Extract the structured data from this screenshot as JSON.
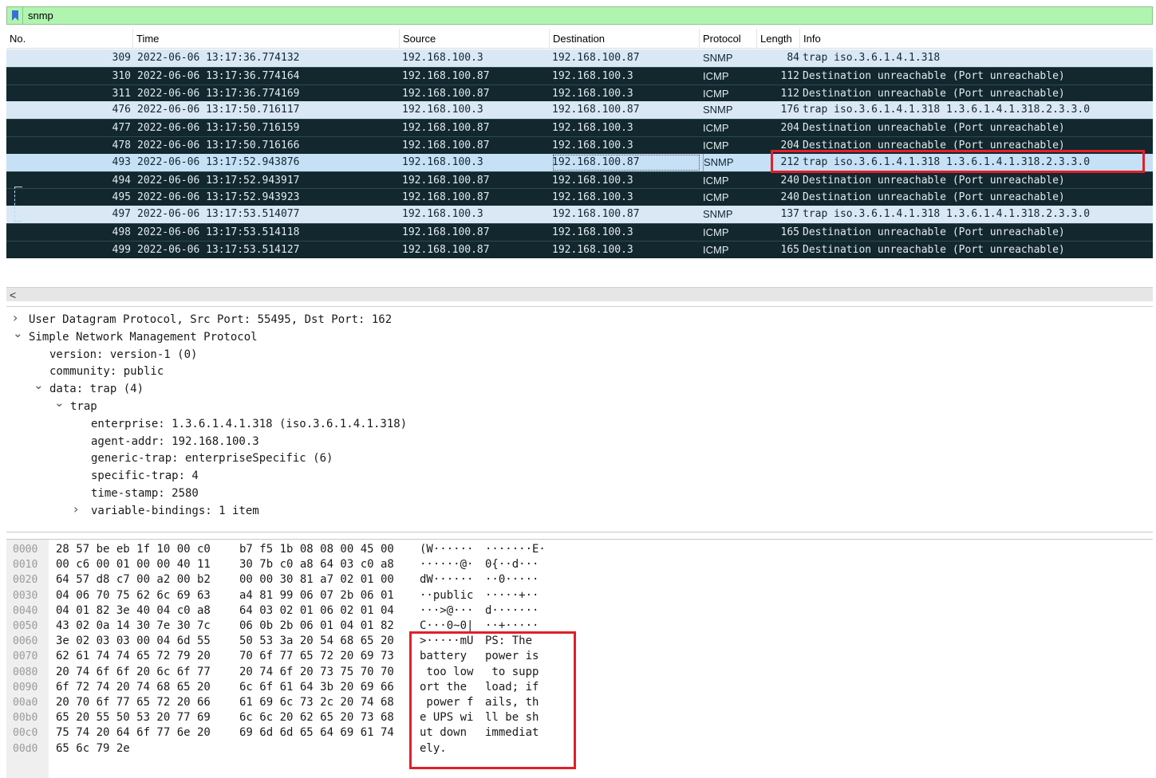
{
  "filter": {
    "value": "snmp",
    "icon": "bookmark-icon"
  },
  "columns": [
    "No.",
    "Time",
    "Source",
    "Destination",
    "Protocol",
    "Length",
    "Info"
  ],
  "packets": [
    {
      "no": "309",
      "time": "2022-06-06 13:17:36.774132",
      "src": "192.168.100.3",
      "dst": "192.168.100.87",
      "proto": "SNMP",
      "len": "84",
      "info": "trap iso.3.6.1.4.1.318",
      "style": "snmp"
    },
    {
      "no": "310",
      "time": "2022-06-06 13:17:36.774164",
      "src": "192.168.100.87",
      "dst": "192.168.100.3",
      "proto": "ICMP",
      "len": "112",
      "info": "Destination unreachable (Port unreachable)",
      "style": "icmp"
    },
    {
      "no": "311",
      "time": "2022-06-06 13:17:36.774169",
      "src": "192.168.100.87",
      "dst": "192.168.100.3",
      "proto": "ICMP",
      "len": "112",
      "info": "Destination unreachable (Port unreachable)",
      "style": "icmp"
    },
    {
      "no": "476",
      "time": "2022-06-06 13:17:50.716117",
      "src": "192.168.100.3",
      "dst": "192.168.100.87",
      "proto": "SNMP",
      "len": "176",
      "info": "trap iso.3.6.1.4.1.318 1.3.6.1.4.1.318.2.3.3.0",
      "style": "snmp"
    },
    {
      "no": "477",
      "time": "2022-06-06 13:17:50.716159",
      "src": "192.168.100.87",
      "dst": "192.168.100.3",
      "proto": "ICMP",
      "len": "204",
      "info": "Destination unreachable (Port unreachable)",
      "style": "icmp"
    },
    {
      "no": "478",
      "time": "2022-06-06 13:17:50.716166",
      "src": "192.168.100.87",
      "dst": "192.168.100.3",
      "proto": "ICMP",
      "len": "204",
      "info": "Destination unreachable (Port unreachable)",
      "style": "icmp"
    },
    {
      "no": "493",
      "time": "2022-06-06 13:17:52.943876",
      "src": "192.168.100.3",
      "dst": "192.168.100.87",
      "proto": "SNMP",
      "len": "212",
      "info": "trap iso.3.6.1.4.1.318 1.3.6.1.4.1.318.2.3.3.0",
      "style": "selected"
    },
    {
      "no": "494",
      "time": "2022-06-06 13:17:52.943917",
      "src": "192.168.100.87",
      "dst": "192.168.100.3",
      "proto": "ICMP",
      "len": "240",
      "info": "Destination unreachable (Port unreachable)",
      "style": "icmp"
    },
    {
      "no": "495",
      "time": "2022-06-06 13:17:52.943923",
      "src": "192.168.100.87",
      "dst": "192.168.100.3",
      "proto": "ICMP",
      "len": "240",
      "info": "Destination unreachable (Port unreachable)",
      "style": "icmp"
    },
    {
      "no": "497",
      "time": "2022-06-06 13:17:53.514077",
      "src": "192.168.100.3",
      "dst": "192.168.100.87",
      "proto": "SNMP",
      "len": "137",
      "info": "trap iso.3.6.1.4.1.318 1.3.6.1.4.1.318.2.3.3.0",
      "style": "snmp"
    },
    {
      "no": "498",
      "time": "2022-06-06 13:17:53.514118",
      "src": "192.168.100.87",
      "dst": "192.168.100.3",
      "proto": "ICMP",
      "len": "165",
      "info": "Destination unreachable (Port unreachable)",
      "style": "icmp"
    },
    {
      "no": "499",
      "time": "2022-06-06 13:17:53.514127",
      "src": "192.168.100.87",
      "dst": "192.168.100.3",
      "proto": "ICMP",
      "len": "165",
      "info": "Destination unreachable (Port unreachable)",
      "style": "icmp"
    }
  ],
  "scroll_left": "<",
  "details": [
    {
      "arrow": ">",
      "text": "User Datagram Protocol, Src Port: 55495, Dst Port: 162"
    },
    {
      "arrow": "v",
      "text": "Simple Network Management Protocol"
    },
    {
      "arrow": "",
      "text": "version: version-1 (0)"
    },
    {
      "arrow": "",
      "text": "community: public"
    },
    {
      "arrow": "v",
      "text": "data: trap (4)"
    },
    {
      "arrow": "v",
      "text": "trap"
    },
    {
      "arrow": "",
      "text": "enterprise: 1.3.6.1.4.1.318 (iso.3.6.1.4.1.318)"
    },
    {
      "arrow": "",
      "text": "agent-addr: 192.168.100.3"
    },
    {
      "arrow": "",
      "text": "generic-trap: enterpriseSpecific (6)"
    },
    {
      "arrow": "",
      "text": "specific-trap: 4"
    },
    {
      "arrow": "",
      "text": "time-stamp: 2580"
    },
    {
      "arrow": ">",
      "text": "variable-bindings: 1 item"
    }
  ],
  "hexdump": [
    {
      "off": "0000",
      "h1": "28 57 be eb 1f 10 00 c0",
      "h2": "b7 f5 1b 08 08 00 45 00",
      "a1": "(W······",
      "a2": "·······E·"
    },
    {
      "off": "0010",
      "h1": "00 c6 00 01 00 00 40 11",
      "h2": "30 7b c0 a8 64 03 c0 a8",
      "a1": "······@·",
      "a2": "0{··d···"
    },
    {
      "off": "0020",
      "h1": "64 57 d8 c7 00 a2 00 b2",
      "h2": "00 00 30 81 a7 02 01 00",
      "a1": "dW······",
      "a2": "··0·····"
    },
    {
      "off": "0030",
      "h1": "04 06 70 75 62 6c 69 63",
      "h2": "a4 81 99 06 07 2b 06 01",
      "a1": "··public",
      "a2": "·····+··"
    },
    {
      "off": "0040",
      "h1": "04 01 82 3e 40 04 c0 a8",
      "h2": "64 03 02 01 06 02 01 04",
      "a1": "···>@···",
      "a2": "d·······"
    },
    {
      "off": "0050",
      "h1": "43 02 0a 14 30 7e 30 7c",
      "h2": "06 0b 2b 06 01 04 01 82",
      "a1": "C···0~0|",
      "a2": "··+·····"
    },
    {
      "off": "0060",
      "h1": "3e 02 03 03 00 04 6d 55",
      "h2": "50 53 3a 20 54 68 65 20",
      "a1": ">·····mU",
      "a2": "PS: The "
    },
    {
      "off": "0070",
      "h1": "62 61 74 74 65 72 79 20",
      "h2": "70 6f 77 65 72 20 69 73",
      "a1": "battery ",
      "a2": "power is"
    },
    {
      "off": "0080",
      "h1": "20 74 6f 6f 20 6c 6f 77",
      "h2": "20 74 6f 20 73 75 70 70",
      "a1": " too low",
      "a2": " to supp"
    },
    {
      "off": "0090",
      "h1": "6f 72 74 20 74 68 65 20",
      "h2": "6c 6f 61 64 3b 20 69 66",
      "a1": "ort the ",
      "a2": "load; if"
    },
    {
      "off": "00a0",
      "h1": "20 70 6f 77 65 72 20 66",
      "h2": "61 69 6c 73 2c 20 74 68",
      "a1": " power f",
      "a2": "ails, th"
    },
    {
      "off": "00b0",
      "h1": "65 20 55 50 53 20 77 69",
      "h2": "6c 6c 20 62 65 20 73 68",
      "a1": "e UPS wi",
      "a2": "ll be sh"
    },
    {
      "off": "00c0",
      "h1": "75 74 20 64 6f 77 6e 20",
      "h2": "69 6d 6d 65 64 69 61 74",
      "a1": "ut down ",
      "a2": "immediat"
    },
    {
      "off": "00d0",
      "h1": "65 6c 79 2e",
      "h2": "",
      "a1": "ely.",
      "a2": ""
    }
  ],
  "colors": {
    "snmp_row": "#dae8f5",
    "icmp_row": "#12272e",
    "icmp_text": "#e0ebee",
    "filter_bg": "#aff5af",
    "highlight": "#e0202a"
  }
}
